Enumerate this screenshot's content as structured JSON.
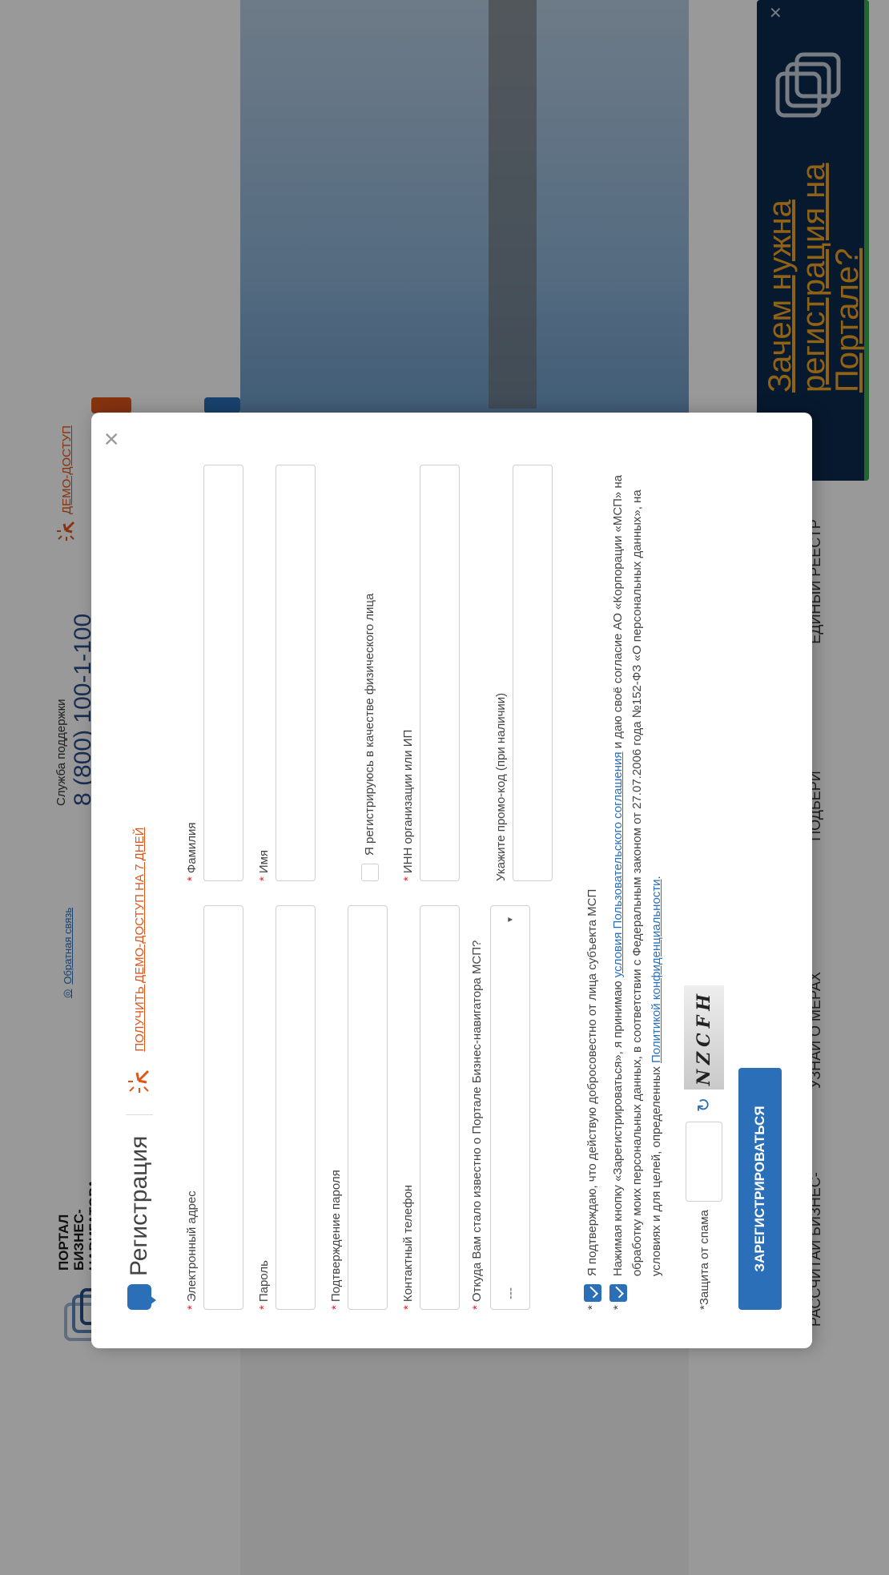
{
  "header": {
    "logo_text": "ПОРТАЛ БИЗНЕС-НАВИГАТОРА",
    "feedback_label": "Обратная связь",
    "support_label": "Служба поддержки",
    "support_phone": "8 (800) 100-1-100",
    "demo_label": "ДЕМО-ДОСТУП"
  },
  "nav": {
    "items": [
      {
        "label": "РАССЧИТАЙ БИЗНЕС-",
        "icon": "calculator-icon"
      },
      {
        "label": "УЗНАЙ О МЕРАХ",
        "icon": "chart-icon"
      },
      {
        "label": "ПОДБЕРИ",
        "icon": "building-icon"
      },
      {
        "label": "ЕДИНЫЙ РЕЕСТР",
        "icon": "emblem-icon"
      }
    ]
  },
  "promo": {
    "text": "Зачем нужна регистрация на Портале?",
    "close": "×"
  },
  "modal": {
    "close": "×",
    "title": "Регистрация",
    "demo_link": "ПОЛУЧИТЬ ДЕМО-ДОСТУП НА 7 ДНЕЙ",
    "req": "*",
    "fields": {
      "email": {
        "label": "Электронный адрес",
        "value": ""
      },
      "last_name": {
        "label": "Фамилия",
        "value": ""
      },
      "password": {
        "label": "Пароль",
        "value": ""
      },
      "first_name": {
        "label": "Имя",
        "value": ""
      },
      "password_confirm": {
        "label": "Подтверждение пароля",
        "value": ""
      },
      "individual": {
        "label": "Я регистрируюсь в качестве физического лица",
        "checked": false
      },
      "phone": {
        "label": "Контактный телефон",
        "value": ""
      },
      "inn": {
        "label": "ИНН организации или ИП",
        "value": ""
      },
      "source": {
        "label": "Откуда Вам стало известно о Портале Бизнес-навигатора МСП?",
        "selected": "---"
      },
      "promo_code": {
        "label": "Укажите промо-код (при наличии)",
        "value": ""
      }
    },
    "consent1": "Я подтверждаю, что действую добросовестно от лица субъекта МСП",
    "consent2": {
      "part1": "Нажимая кнопку «Зарегистрироваться», я принимаю ",
      "link1": "условия Пользовательского соглашения",
      "part2": " и даю своё согласие АО «Корпорации «МСП» на обработку моих персональных данных, в соответствии с Федеральным законом от 27.07.2006 года №152-ФЗ «О персональных данных», на условиях и для целей, определенных ",
      "link2": "Политикой конфиденциальности",
      "part3": "."
    },
    "spam_label": "Защита от спама",
    "captcha_text": "NZCFH",
    "submit": "ЗАРЕГИСТРИРОВАТЬСЯ"
  }
}
